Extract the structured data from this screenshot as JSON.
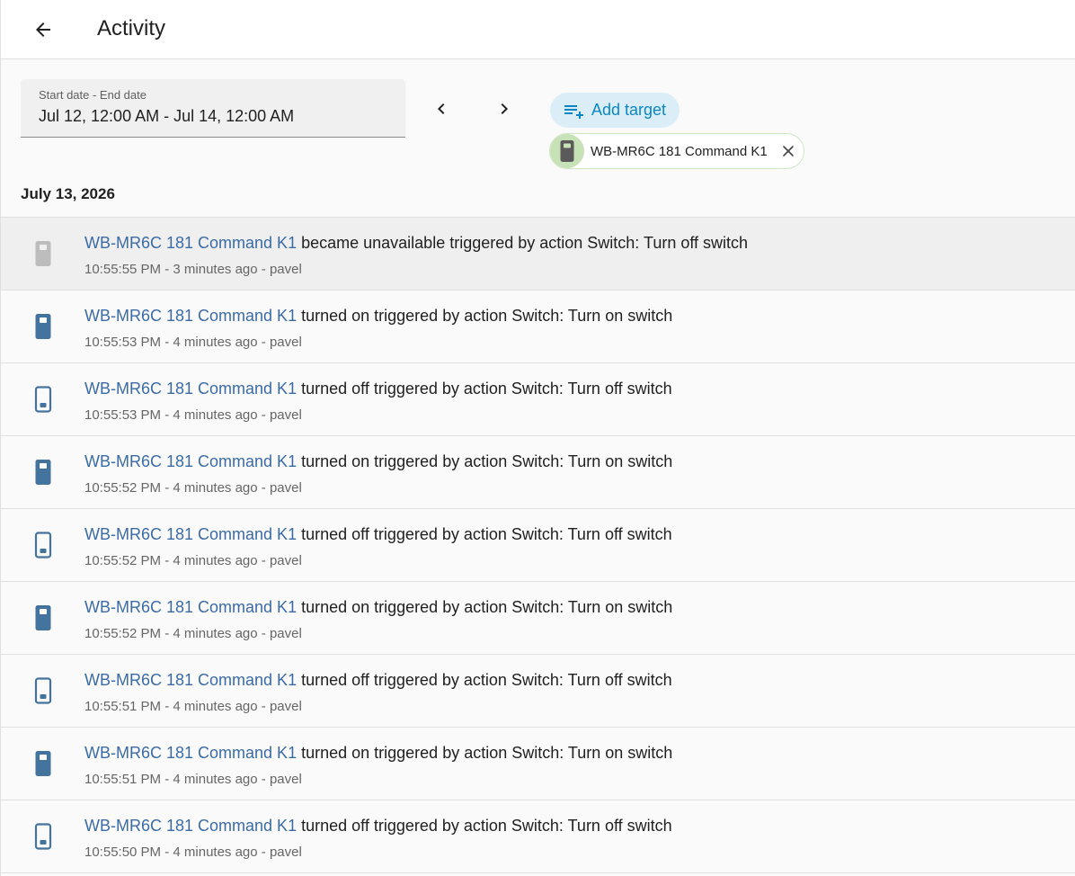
{
  "header": {
    "title": "Activity"
  },
  "date_range": {
    "label": "Start date - End date",
    "value": "Jul 12, 12:00 AM - Jul 14, 12:00 AM"
  },
  "targets": {
    "add_label": "Add target",
    "chips": [
      {
        "label": "WB-MR6C 181 Command K1"
      }
    ]
  },
  "day_header": "July 13, 2026",
  "colors": {
    "accent": "#0b86c5",
    "entity_link": "#3b6ba5",
    "icon_on": "#44739e",
    "icon_unavailable": "#bdbdbd"
  },
  "entries": [
    {
      "entity": "WB-MR6C 181 Command K1",
      "message": "became unavailable triggered by action Switch: Turn off switch",
      "meta": "10:55:55 PM - 3 minutes ago - pavel",
      "state": "unavailable"
    },
    {
      "entity": "WB-MR6C 181 Command K1",
      "message": "turned on triggered by action Switch: Turn on switch",
      "meta": "10:55:53 PM - 4 minutes ago - pavel",
      "state": "on"
    },
    {
      "entity": "WB-MR6C 181 Command K1",
      "message": "turned off triggered by action Switch: Turn off switch",
      "meta": "10:55:53 PM - 4 minutes ago - pavel",
      "state": "off"
    },
    {
      "entity": "WB-MR6C 181 Command K1",
      "message": "turned on triggered by action Switch: Turn on switch",
      "meta": "10:55:52 PM - 4 minutes ago - pavel",
      "state": "on"
    },
    {
      "entity": "WB-MR6C 181 Command K1",
      "message": "turned off triggered by action Switch: Turn off switch",
      "meta": "10:55:52 PM - 4 minutes ago - pavel",
      "state": "off"
    },
    {
      "entity": "WB-MR6C 181 Command K1",
      "message": "turned on triggered by action Switch: Turn on switch",
      "meta": "10:55:52 PM - 4 minutes ago - pavel",
      "state": "on"
    },
    {
      "entity": "WB-MR6C 181 Command K1",
      "message": "turned off triggered by action Switch: Turn off switch",
      "meta": "10:55:51 PM - 4 minutes ago - pavel",
      "state": "off"
    },
    {
      "entity": "WB-MR6C 181 Command K1",
      "message": "turned on triggered by action Switch: Turn on switch",
      "meta": "10:55:51 PM - 4 minutes ago - pavel",
      "state": "on"
    },
    {
      "entity": "WB-MR6C 181 Command K1",
      "message": "turned off triggered by action Switch: Turn off switch",
      "meta": "10:55:50 PM - 4 minutes ago - pavel",
      "state": "off"
    }
  ]
}
